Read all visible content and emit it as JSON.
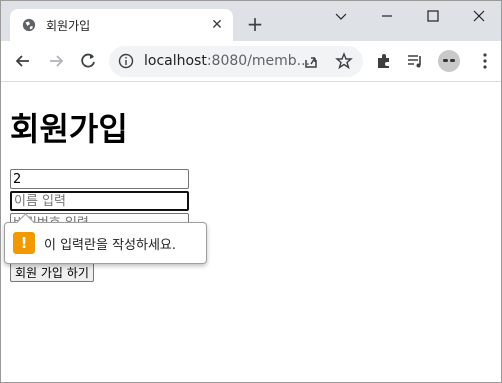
{
  "browser": {
    "tab_title": "회원가입",
    "url_host": "localhost",
    "url_rest": ":8080/memb...",
    "icons": [
      "globe-icon",
      "close-icon",
      "plus-icon",
      "chevron-down-icon",
      "minimize-icon",
      "maximize-icon",
      "close-window-icon",
      "back-icon",
      "forward-icon",
      "reload-icon",
      "info-icon",
      "share-icon",
      "star-icon",
      "extensions-icon",
      "media-icon",
      "profile-avatar",
      "menu-icon"
    ]
  },
  "page": {
    "title": "회원가입",
    "fields": {
      "id_value": "2",
      "name_placeholder": "이름 입력",
      "password_placeholder": "비밀번호 입력"
    },
    "submit_label": "회원 가입 하기",
    "validation_message": "이 입력란을 작성하세요.",
    "warning_glyph": "!"
  },
  "colors": {
    "titlebar": "#dee1e6",
    "warning": "#f29900"
  }
}
